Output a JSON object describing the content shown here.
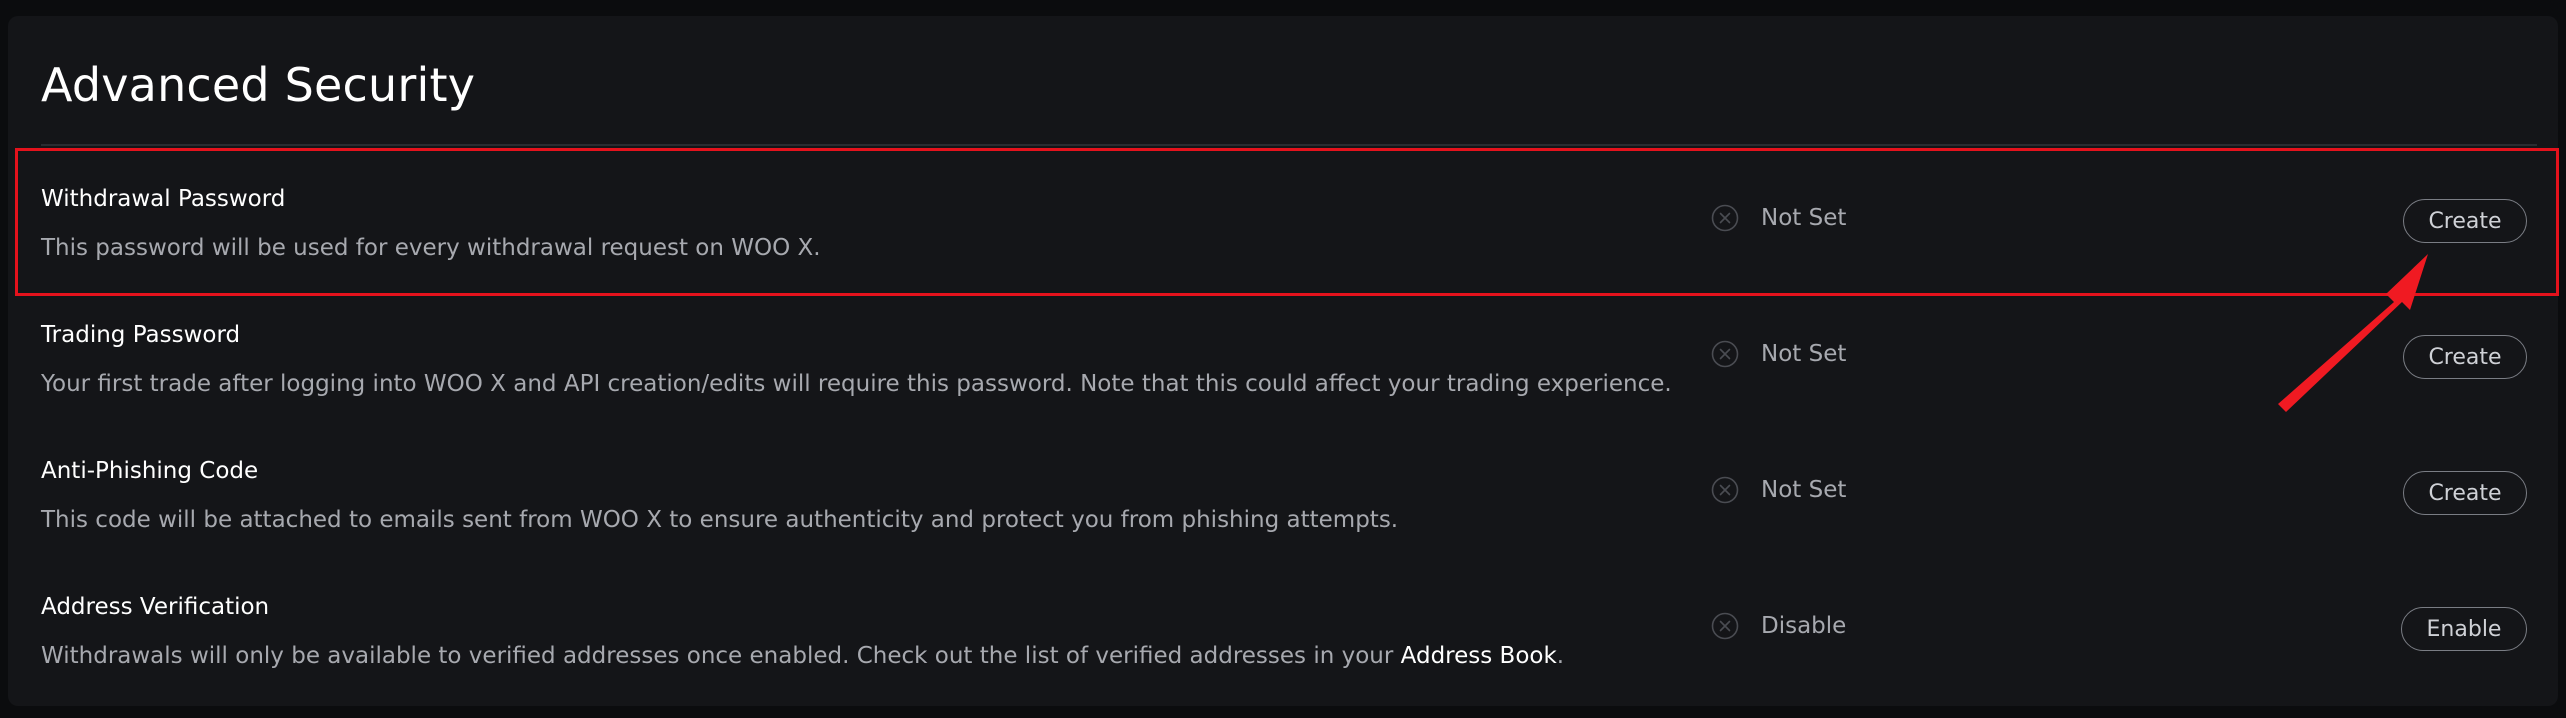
{
  "section": {
    "title": "Advanced Security"
  },
  "rows": [
    {
      "title": "Withdrawal Password",
      "description": "This password will be used for every withdrawal request on WOO X.",
      "status": "Not Set",
      "action": "Create"
    },
    {
      "title": "Trading Password",
      "description": "Your first trade after logging into WOO X and API creation/edits will require this password. Note that this could affect your trading experience.",
      "status": "Not Set",
      "action": "Create"
    },
    {
      "title": "Anti-Phishing Code",
      "description": "This code will be attached to emails sent from WOO X to ensure authenticity and protect you from phishing attempts.",
      "status": "Not Set",
      "action": "Create"
    },
    {
      "title": "Address Verification",
      "description_prefix": "Withdrawals will only be available to verified addresses once enabled. Check out the list of verified addresses in your ",
      "description_link": "Address Book",
      "description_suffix": ".",
      "status": "Disable",
      "action": "Enable"
    }
  ],
  "icons": {
    "status": "close-circle-icon"
  },
  "colors": {
    "background": "#0b0c0e",
    "panel": "#141518",
    "highlight": "#e4121c",
    "text_primary": "#ffffff",
    "text_secondary": "#a7a9af"
  }
}
